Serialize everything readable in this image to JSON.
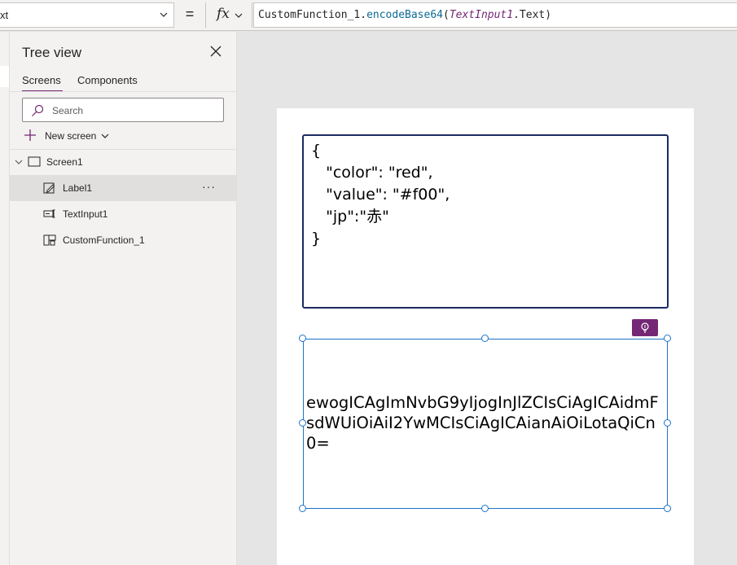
{
  "formula_bar": {
    "property_value": "xt",
    "equals": "=",
    "fx_label": "fx",
    "formula": {
      "fn": "CustomFunction_1.",
      "method": "encodeBase64",
      "open": "(",
      "control": "TextInput1",
      "rest": ".Text)"
    }
  },
  "tree_view": {
    "title": "Tree view",
    "tabs": {
      "screens": "Screens",
      "components": "Components"
    },
    "search_placeholder": "Search",
    "new_screen_label": "New screen",
    "items": {
      "screen": "Screen1",
      "label": "Label1",
      "text_input": "TextInput1",
      "custom_function": "CustomFunction_1"
    },
    "more_label": "···"
  },
  "canvas": {
    "text_input_value": "{\n   \"color\": \"red\",\n   \"value\": \"#f00\",\n   \"jp\":\"赤\"\n}",
    "label_text": "ewogICAgImNvbG9yIjogInJlZCIsCiAgICAidmFsdWUiOiAiI2YwMCIsCiAgICAianAiOiLotaQiCn0="
  },
  "colors": {
    "accent": "#742774",
    "selection": "#1d73c9",
    "input_border": "#1b2b62"
  }
}
